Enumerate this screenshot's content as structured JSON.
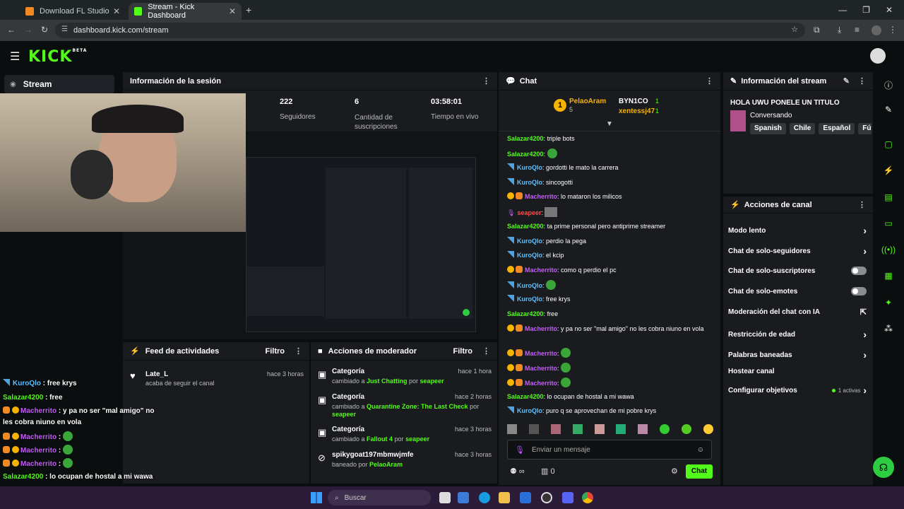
{
  "browser": {
    "tabs": [
      {
        "label": "Download FL Studio"
      },
      {
        "label": "Stream - Kick Dashboard"
      }
    ],
    "url": "dashboard.kick.com/stream"
  },
  "header": {
    "logo": "KICK",
    "logo_sup": "BETA"
  },
  "left_nav": {
    "stream_label": "Stream"
  },
  "session": {
    "title": "Información de la sesión",
    "stats": [
      {
        "value": "222",
        "label": "Seguidores"
      },
      {
        "value": "6",
        "label": "Cantidad de suscripciones"
      },
      {
        "value": "03:58:01",
        "label": "Tiempo en vivo"
      }
    ]
  },
  "activity": {
    "title": "Feed de actividades",
    "filter": "Filtro",
    "items": [
      {
        "user": "Late_L",
        "text": "acaba de seguir el canal",
        "time": "hace 3 horas"
      }
    ]
  },
  "moderator": {
    "title": "Acciones de moderador",
    "filter": "Filtro",
    "items": [
      {
        "title": "Categoría",
        "pre": "cambiado a ",
        "cat": "Just Chatting",
        "mid": " por ",
        "by": "seapeer",
        "time": "hace 1 hora"
      },
      {
        "title": "Categoría",
        "pre": "cambiado a ",
        "cat": "Quarantine Zone: The Last Check",
        "mid": " por ",
        "by": "seapeer",
        "time": "hace 2 horas"
      },
      {
        "title": "Categoría",
        "pre": "cambiado a ",
        "cat": "Fallout 4",
        "mid": " por ",
        "by": "seapeer",
        "time": "hace 3 horas"
      },
      {
        "title": "spikygoat197mbmwjmfe",
        "pre": "baneado por ",
        "by": "PelaoAram",
        "time": "hace 3 horas"
      }
    ]
  },
  "chat": {
    "title": "Chat",
    "leaders": [
      {
        "name": "PelaoAram",
        "count": "5"
      },
      {
        "name": "BYN1CO",
        "count": "1"
      },
      {
        "name": "xentessj47",
        "count": "1"
      }
    ],
    "rank": "1",
    "messages": [
      {
        "user": "Salazar4200",
        "text": "triple bots"
      },
      {
        "user": "Salazar4200",
        "text": ""
      },
      {
        "user": "KuroQlo",
        "text": "gordotti le mato la carrera"
      },
      {
        "user": "KuroQlo",
        "text": "sincogotti"
      },
      {
        "user": "Macherrito",
        "text": "lo mataron los milicos"
      },
      {
        "user": "seapeer",
        "text": ""
      },
      {
        "user": "Salazar4200",
        "text": "ta prime personal pero antiprime streamer"
      },
      {
        "user": "KuroQlo",
        "text": "perdio la pega"
      },
      {
        "user": "KuroQlo",
        "text": "el kcip"
      },
      {
        "user": "Macherrito",
        "text": "como q perdio el pc"
      },
      {
        "user": "KuroQlo",
        "text": ""
      },
      {
        "user": "KuroQlo",
        "text": "free krys"
      },
      {
        "user": "Salazar4200",
        "text": "free"
      },
      {
        "user": "Macherrito",
        "text": "y pa no ser \"mal amigo\" no les cobra niuno en vola"
      },
      {
        "user": "Macherrito",
        "text": ""
      },
      {
        "user": "Macherrito",
        "text": ""
      },
      {
        "user": "Macherrito",
        "text": ""
      },
      {
        "user": "Salazar4200",
        "text": "lo ocupan de hostal a mi wawa"
      },
      {
        "user": "KuroQlo",
        "text": "puro q se aprovechan de mi pobre krys"
      }
    ],
    "input_placeholder": "Enviar un mensaje",
    "viewers": "0",
    "send_label": "Chat"
  },
  "stream_info": {
    "title": "Información del stream",
    "stream_title": "HOLA UWU PONELE UN TITULO",
    "category": "Conversando",
    "tags": [
      "Spanish",
      "Chile",
      "Español",
      "Fút"
    ]
  },
  "channel_actions": {
    "title": "Acciones de canal",
    "items": [
      {
        "label": "Modo lento",
        "control": "chevron"
      },
      {
        "label": "Chat de solo-seguidores",
        "control": "chevron"
      },
      {
        "label": "Chat de solo-suscriptores",
        "control": "toggle"
      },
      {
        "label": "Chat de solo-emotes",
        "control": "toggle"
      },
      {
        "label": "Moderación del chat con IA",
        "control": "external"
      },
      {
        "label": "Restricción de edad",
        "control": "chevron"
      },
      {
        "label": "Palabras baneadas",
        "control": "chevron"
      },
      {
        "label": "Hostear canal",
        "control": "none"
      },
      {
        "label": "Configurar objetivos",
        "control": "chevron",
        "note": "1 activas"
      }
    ]
  },
  "overlay_chat": [
    {
      "user": "KuroQlo",
      "text": "free krys"
    },
    {
      "user": "Salazar4200",
      "text": "free"
    },
    {
      "user": "Macherrito",
      "text": "y pa no ser \"mal amigo\" no"
    },
    {
      "user": "",
      "text": "les cobra niuno en vola"
    },
    {
      "user": "Macherrito",
      "text": ""
    },
    {
      "user": "Macherrito",
      "text": ""
    },
    {
      "user": "Macherrito",
      "text": ""
    },
    {
      "user": "Salazar4200",
      "text": "lo ocupan de hostal a mi wawa"
    },
    {
      "user": "KuroQlo",
      "text": "puro q se aprovechan de mi pobre"
    },
    {
      "user": "",
      "text": "krys"
    }
  ],
  "taskbar": {
    "search_placeholder": "Buscar"
  },
  "colors": {
    "accent": "#53fc18",
    "panel": "#191b1f",
    "bg": "#0b0e0f"
  }
}
